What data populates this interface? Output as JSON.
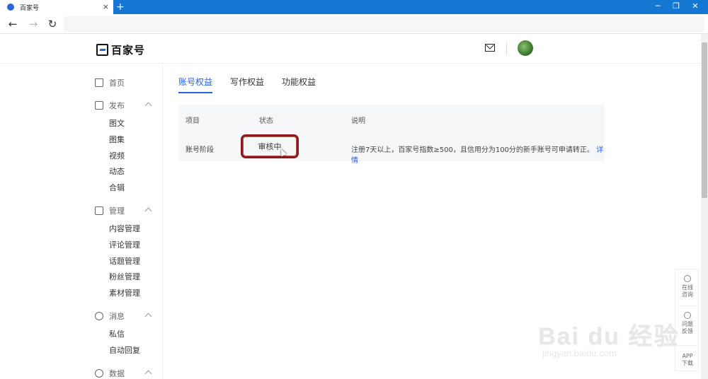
{
  "browser": {
    "tab_title": "百家号",
    "new_tab": "+",
    "close_tab": "×",
    "minimize": "─",
    "maximize": "❐",
    "close_window": "✕",
    "back": "←",
    "forward": "→",
    "reload": "↻"
  },
  "header": {
    "logo_text": "百家号"
  },
  "sidebar": {
    "home": "首页",
    "publish": {
      "label": "发布",
      "items": [
        "图文",
        "图集",
        "视频",
        "动态",
        "合辑"
      ]
    },
    "manage": {
      "label": "管理",
      "items": [
        "内容管理",
        "评论管理",
        "话题管理",
        "粉丝管理",
        "素材管理"
      ]
    },
    "messages": {
      "label": "消息",
      "items": [
        "私信",
        "自动回复"
      ]
    },
    "data": {
      "label": "数据"
    }
  },
  "tabs": [
    "账号权益",
    "写作权益",
    "功能权益"
  ],
  "table": {
    "headers": [
      "项目",
      "状态",
      "说明"
    ],
    "row": {
      "item": "账号阶段",
      "status": "审核中",
      "desc": "注册7天以上，百家号指数≥500，且信用分为100分的新手账号可申请转正。",
      "link": "详情"
    }
  },
  "float_panel": {
    "online_line1": "在线",
    "online_line2": "咨询",
    "feedback_line1": "问题",
    "feedback_line2": "反馈",
    "app_line1": "APP",
    "app_line2": "下载"
  },
  "watermark": {
    "main": "Bai du 经验",
    "sub": "jingyan.baidu.com"
  }
}
